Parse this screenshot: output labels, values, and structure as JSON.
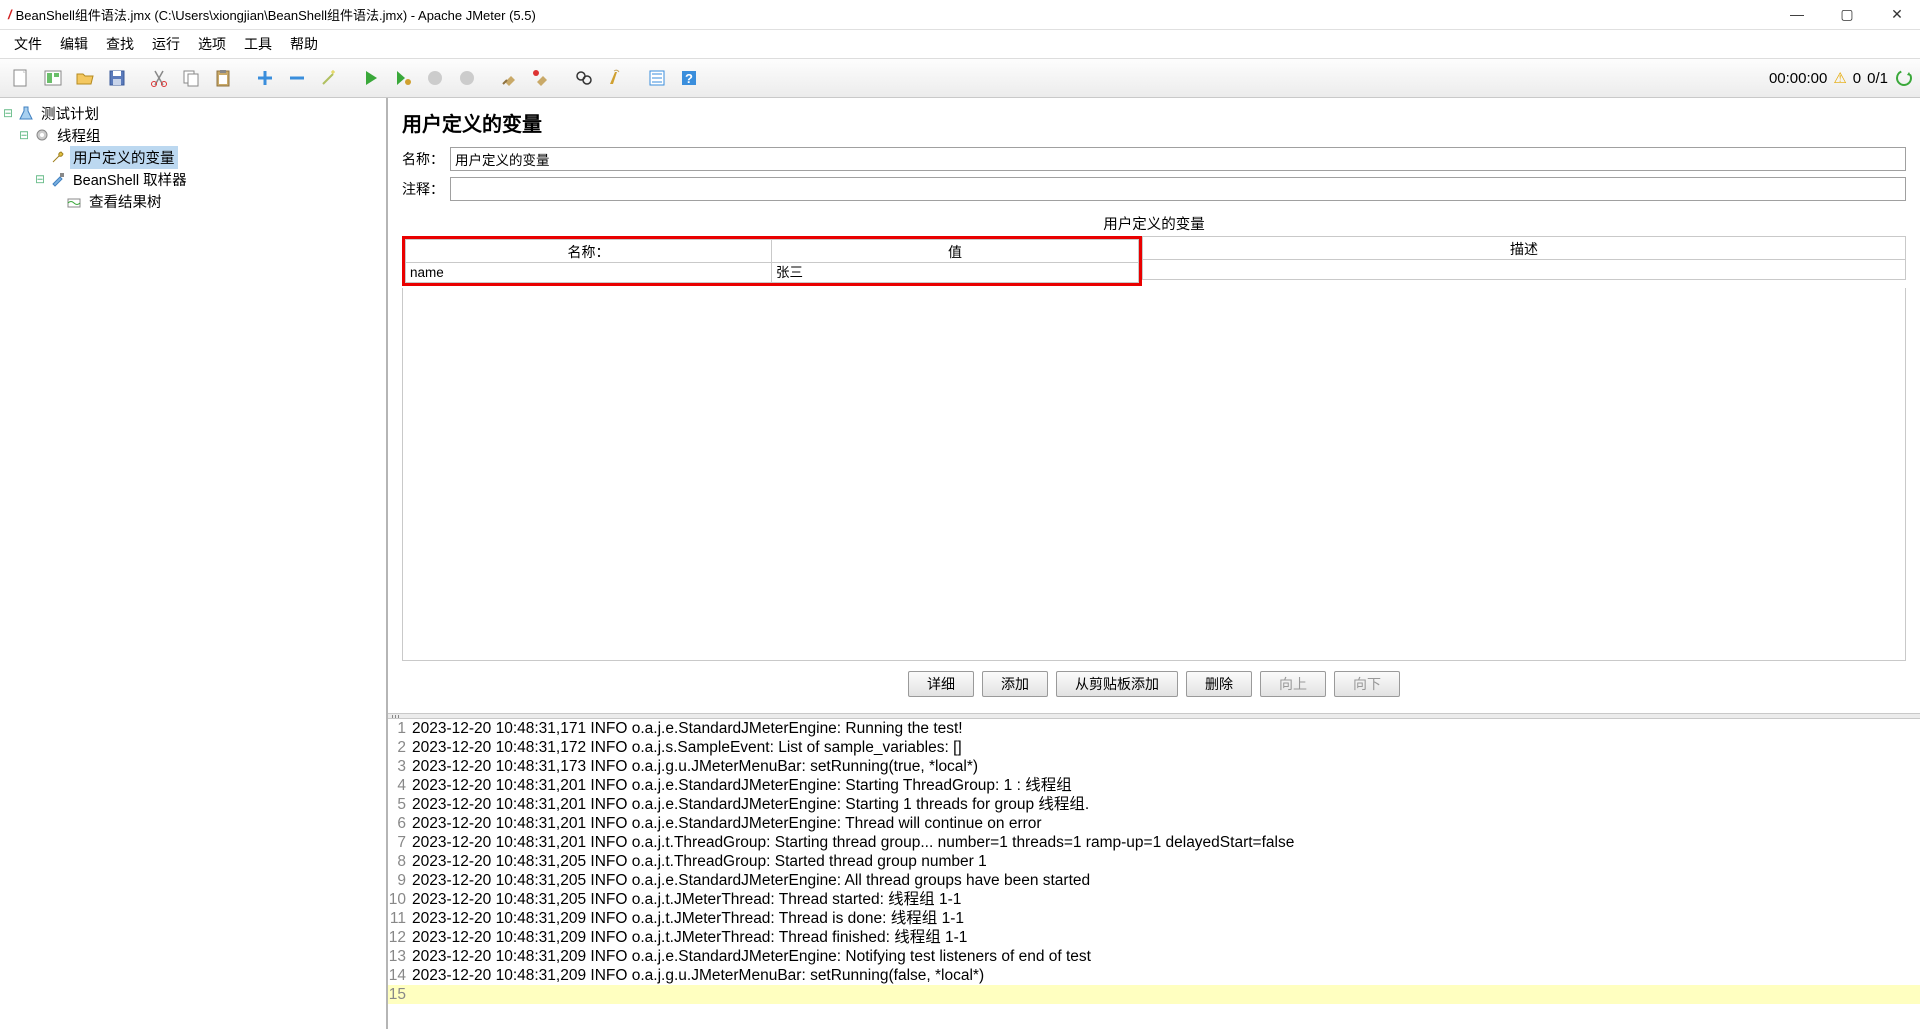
{
  "window": {
    "title": "BeanShell组件语法.jmx (C:\\Users\\xiongjian\\BeanShell组件语法.jmx) - Apache JMeter (5.5)"
  },
  "menu": [
    "文件",
    "编辑",
    "查找",
    "运行",
    "选项",
    "工具",
    "帮助"
  ],
  "status": {
    "time": "00:00:00",
    "warn_count": "0",
    "threads": "0/1"
  },
  "tree": {
    "root": "测试计划",
    "thread_group": "线程组",
    "user_vars": "用户定义的变量",
    "beanshell": "BeanShell 取样器",
    "result_tree": "查看结果树"
  },
  "editor": {
    "heading": "用户定义的变量",
    "name_label": "名称：",
    "name_value": "用户定义的变量",
    "comment_label": "注释：",
    "comment_value": "",
    "section_title": "用户定义的变量",
    "col_name": "名称：",
    "col_value": "值",
    "col_desc": "描述",
    "row": {
      "name": "name",
      "value": "张三",
      "desc": ""
    },
    "buttons": {
      "detail": "详细",
      "add": "添加",
      "clipboard": "从剪贴板添加",
      "del": "删除",
      "up": "向上",
      "down": "向下"
    }
  },
  "log": [
    "2023-12-20 10:48:31,171 INFO o.a.j.e.StandardJMeterEngine: Running the test!",
    "2023-12-20 10:48:31,172 INFO o.a.j.s.SampleEvent: List of sample_variables: []",
    "2023-12-20 10:48:31,173 INFO o.a.j.g.u.JMeterMenuBar: setRunning(true, *local*)",
    "2023-12-20 10:48:31,201 INFO o.a.j.e.StandardJMeterEngine: Starting ThreadGroup: 1 : 线程组",
    "2023-12-20 10:48:31,201 INFO o.a.j.e.StandardJMeterEngine: Starting 1 threads for group 线程组.",
    "2023-12-20 10:48:31,201 INFO o.a.j.e.StandardJMeterEngine: Thread will continue on error",
    "2023-12-20 10:48:31,201 INFO o.a.j.t.ThreadGroup: Starting thread group... number=1 threads=1 ramp-up=1 delayedStart=false",
    "2023-12-20 10:48:31,205 INFO o.a.j.t.ThreadGroup: Started thread group number 1",
    "2023-12-20 10:48:31,205 INFO o.a.j.e.StandardJMeterEngine: All thread groups have been started",
    "2023-12-20 10:48:31,205 INFO o.a.j.t.JMeterThread: Thread started: 线程组 1-1",
    "2023-12-20 10:48:31,209 INFO o.a.j.t.JMeterThread: Thread is done: 线程组 1-1",
    "2023-12-20 10:48:31,209 INFO o.a.j.t.JMeterThread: Thread finished: 线程组 1-1",
    "2023-12-20 10:48:31,209 INFO o.a.j.e.StandardJMeterEngine: Notifying test listeners of end of test",
    "2023-12-20 10:48:31,209 INFO o.a.j.g.u.JMeterMenuBar: setRunning(false, *local*)"
  ]
}
